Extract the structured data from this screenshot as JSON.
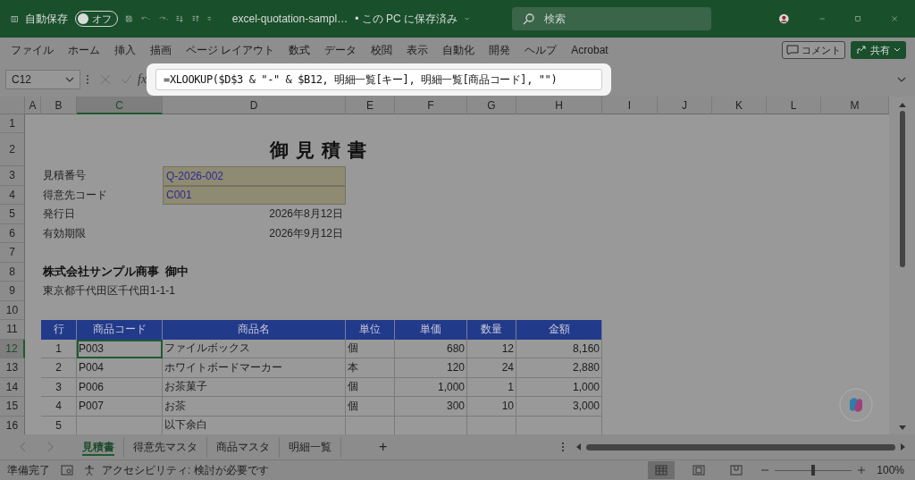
{
  "title_bar": {
    "autosave_label": "自動保存",
    "autosave_toggle": {
      "label": "オフ",
      "on": false
    },
    "file_name": "excel-quotation-sampl…",
    "save_status": "• この PC に保存済み",
    "search": {
      "placeholder": "検索"
    }
  },
  "menu": {
    "items": [
      "ファイル",
      "ホーム",
      "挿入",
      "描画",
      "ページ レイアウト",
      "数式",
      "データ",
      "校閲",
      "表示",
      "自動化",
      "開発",
      "ヘルプ",
      "Acrobat"
    ],
    "comment_button": "コメント",
    "share_button": "共有"
  },
  "formula_bar": {
    "name_box": "C12",
    "fx": "fx",
    "formula": "=XLOOKUP($D$3 & \"-\" & $B12, 明細一覧[キー], 明細一覧[商品コード], \"\")"
  },
  "sheet": {
    "columns": [
      {
        "label": "A",
        "selected": false
      },
      {
        "label": "B",
        "selected": false
      },
      {
        "label": "C",
        "selected": true
      },
      {
        "label": "D",
        "selected": false
      },
      {
        "label": "E",
        "selected": false
      },
      {
        "label": "F",
        "selected": false
      },
      {
        "label": "G",
        "selected": false
      },
      {
        "label": "H",
        "selected": false
      },
      {
        "label": "I",
        "selected": false
      },
      {
        "label": "J",
        "selected": false
      },
      {
        "label": "K",
        "selected": false
      },
      {
        "label": "L",
        "selected": false
      },
      {
        "label": "M",
        "selected": false
      }
    ],
    "rows": [
      {
        "label": "1",
        "selected": false
      },
      {
        "label": "2",
        "selected": false
      },
      {
        "label": "3",
        "selected": false
      },
      {
        "label": "4",
        "selected": false
      },
      {
        "label": "5",
        "selected": false
      },
      {
        "label": "6",
        "selected": false
      },
      {
        "label": "7",
        "selected": false
      },
      {
        "label": "8",
        "selected": false
      },
      {
        "label": "9",
        "selected": false
      },
      {
        "label": "10",
        "selected": false
      },
      {
        "label": "11",
        "selected": false
      },
      {
        "label": "12",
        "selected": true
      },
      {
        "label": "13",
        "selected": false
      },
      {
        "label": "14",
        "selected": false
      },
      {
        "label": "15",
        "selected": false
      },
      {
        "label": "16",
        "selected": false
      }
    ],
    "title": "御見積書",
    "info": [
      {
        "label": "見積番号",
        "value": "Q-2026-002",
        "kind": "input"
      },
      {
        "label": "得意先コード",
        "value": "C001",
        "kind": "input"
      },
      {
        "label": "発行日",
        "value": "2026年8月12日",
        "kind": "date"
      },
      {
        "label": "有効期限",
        "value": "2026年9月12日",
        "kind": "date"
      }
    ],
    "customer_name": "株式会社サンプル商事  御中",
    "customer_address": "東京都千代田区千代田1-1-1",
    "table": {
      "columns": [
        "行",
        "商品コード",
        "商品名",
        "単位",
        "単価",
        "数量",
        "金額"
      ],
      "rows": [
        {
          "no": "1",
          "code": "P003",
          "name": "ファイルボックス",
          "unit": "個",
          "price": "680",
          "qty": "12",
          "amount": "8,160",
          "selected": true
        },
        {
          "no": "2",
          "code": "P004",
          "name": "ホワイトボードマーカー",
          "unit": "本",
          "price": "120",
          "qty": "24",
          "amount": "2,880",
          "selected": false
        },
        {
          "no": "3",
          "code": "P006",
          "name": "お茶菓子",
          "unit": "個",
          "price": "1,000",
          "qty": "1",
          "amount": "1,000",
          "selected": false
        },
        {
          "no": "4",
          "code": "P007",
          "name": "お茶",
          "unit": "個",
          "price": "300",
          "qty": "10",
          "amount": "3,000",
          "selected": false
        },
        {
          "no": "5",
          "code": "",
          "name": "以下余白",
          "unit": "",
          "price": "",
          "qty": "",
          "amount": "",
          "selected": false
        }
      ]
    }
  },
  "sheet_tabs": [
    {
      "label": "見積書",
      "selected": true
    },
    {
      "label": "得意先マスタ",
      "selected": false
    },
    {
      "label": "商品マスタ",
      "selected": false
    },
    {
      "label": "明細一覧",
      "selected": false
    }
  ],
  "add_sheet": "+",
  "status_bar": {
    "ready": "準備完了",
    "accessibility": "アクセシビリティ: 検討が必要です",
    "views": [
      {
        "selected": true
      },
      {
        "selected": false
      },
      {
        "selected": false
      }
    ],
    "zoom": {
      "level": 0.5,
      "label": "100%"
    }
  }
}
